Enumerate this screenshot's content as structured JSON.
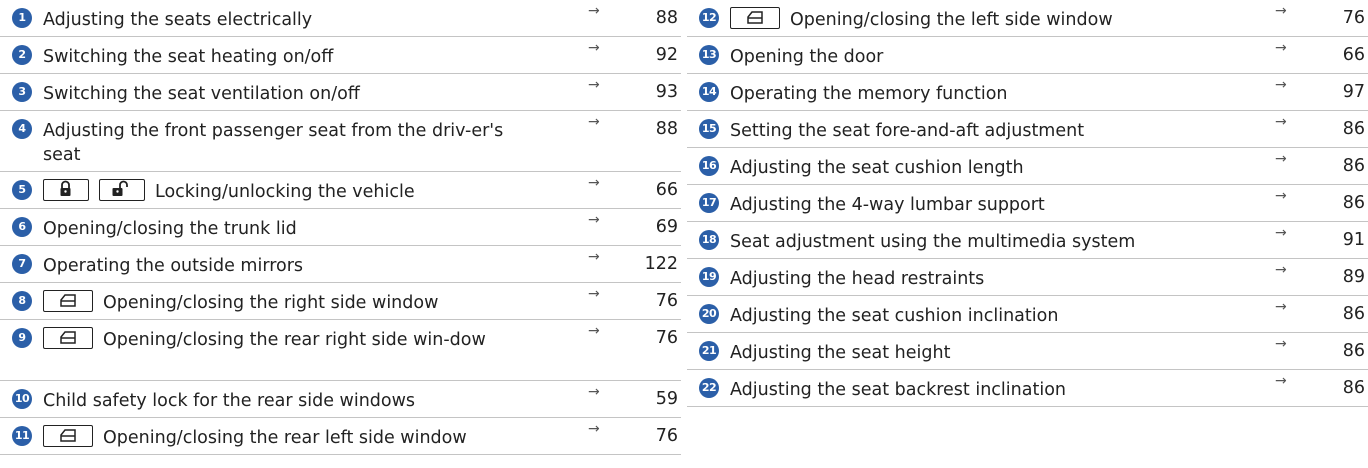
{
  "left_items": [
    {
      "num": "1",
      "text": "Adjusting the seats electrically",
      "arrow": "→",
      "page": "88"
    },
    {
      "num": "2",
      "text": "Switching the seat heating on/off",
      "arrow": "→",
      "page": "92"
    },
    {
      "num": "3",
      "text": "Switching the seat ventilation on/off",
      "arrow": "→",
      "page": "93"
    },
    {
      "num": "4",
      "text": "Adjusting the front passenger seat from the driv-er's seat",
      "arrow": "→",
      "page": "88"
    },
    {
      "num": "5",
      "text": "Locking/unlocking the vehicle",
      "arrow": "→",
      "page": "66",
      "icons": [
        "lock-icon",
        "unlock-icon"
      ]
    },
    {
      "num": "6",
      "text": "Opening/closing the trunk lid",
      "arrow": "→",
      "page": "69"
    },
    {
      "num": "7",
      "text": "Operating the outside mirrors",
      "arrow": "→",
      "page": "122"
    },
    {
      "num": "8",
      "text": "Opening/closing the right side window",
      "arrow": "→",
      "page": "76",
      "icons": [
        "window-icon"
      ]
    },
    {
      "num": "9",
      "text": "Opening/closing the rear right side win-dow",
      "arrow": "→",
      "page": "76",
      "icons": [
        "window-icon"
      ]
    },
    {
      "num": "10",
      "text": "Child safety lock for the rear side windows",
      "arrow": "→",
      "page": "59"
    },
    {
      "num": "11",
      "text": "Opening/closing the rear left side window",
      "arrow": "→",
      "page": "76",
      "icons": [
        "window-icon"
      ]
    }
  ],
  "right_items": [
    {
      "num": "12",
      "text": "Opening/closing the left side window",
      "arrow": "→",
      "page": "76",
      "icons": [
        "window-icon"
      ]
    },
    {
      "num": "13",
      "text": "Opening the door",
      "arrow": "→",
      "page": "66"
    },
    {
      "num": "14",
      "text": "Operating the memory function",
      "arrow": "→",
      "page": "97"
    },
    {
      "num": "15",
      "text": "Setting the seat fore-and-aft adjustment",
      "arrow": "→",
      "page": "86"
    },
    {
      "num": "16",
      "text": "Adjusting the seat cushion length",
      "arrow": "→",
      "page": "86"
    },
    {
      "num": "17",
      "text": "Adjusting the 4-way lumbar support",
      "arrow": "→",
      "page": "86"
    },
    {
      "num": "18",
      "text": "Seat adjustment using the multimedia system",
      "arrow": "→",
      "page": "91"
    },
    {
      "num": "19",
      "text": "Adjusting the head restraints",
      "arrow": "→",
      "page": "89"
    },
    {
      "num": "20",
      "text": "Adjusting the seat cushion inclination",
      "arrow": "→",
      "page": "86"
    },
    {
      "num": "21",
      "text": "Adjusting the seat height",
      "arrow": "→",
      "page": "86"
    },
    {
      "num": "22",
      "text": "Adjusting the seat backrest inclination",
      "arrow": "→",
      "page": "86"
    }
  ],
  "colors": {
    "badge": "#2b5fa8",
    "rule": "#c4c4c4",
    "text": "#222222"
  }
}
